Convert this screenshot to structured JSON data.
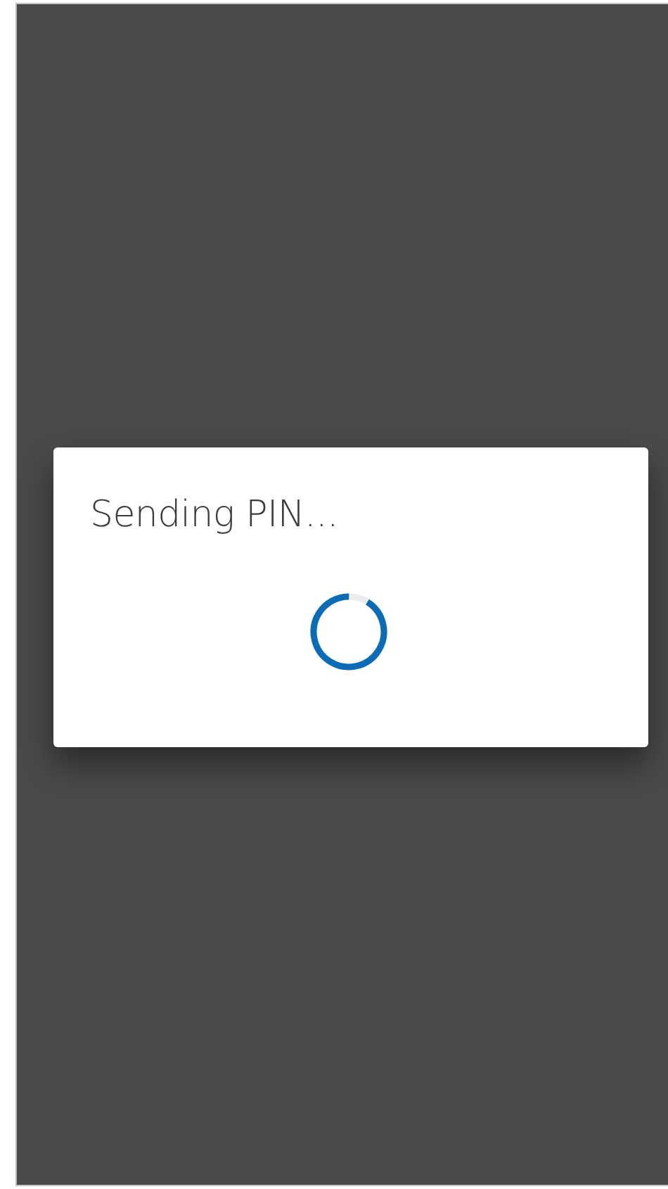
{
  "dialog": {
    "message": "Sending PIN..."
  }
}
